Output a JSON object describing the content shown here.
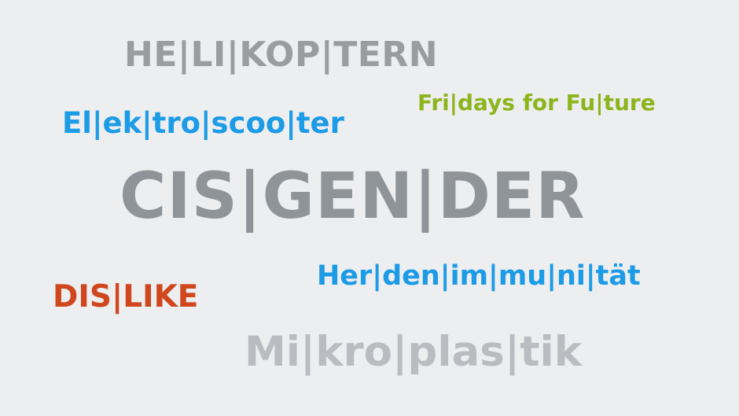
{
  "words": [
    {
      "id": "w-heli",
      "text": "HE|LI|KOP|TERN",
      "color": "#9a9ca0"
    },
    {
      "id": "w-elektro",
      "text": "El|ek|tro|scoo|ter",
      "color": "#1c9be6"
    },
    {
      "id": "w-fridays",
      "text": "Fri|days for Fu|ture",
      "color": "#8cb51d"
    },
    {
      "id": "w-cis",
      "text": "CIS|GEN|DER",
      "color": "#8f9499"
    },
    {
      "id": "w-herden",
      "text": "Her|den|im|mu|ni|tät",
      "color": "#1c9be6"
    },
    {
      "id": "w-dislike",
      "text": "DIS|LIKE",
      "color": "#d0461d"
    },
    {
      "id": "w-mikro",
      "text": "Mi|kro|plas|tik",
      "color": "#b9bcc0"
    }
  ],
  "background": "#edeef0"
}
